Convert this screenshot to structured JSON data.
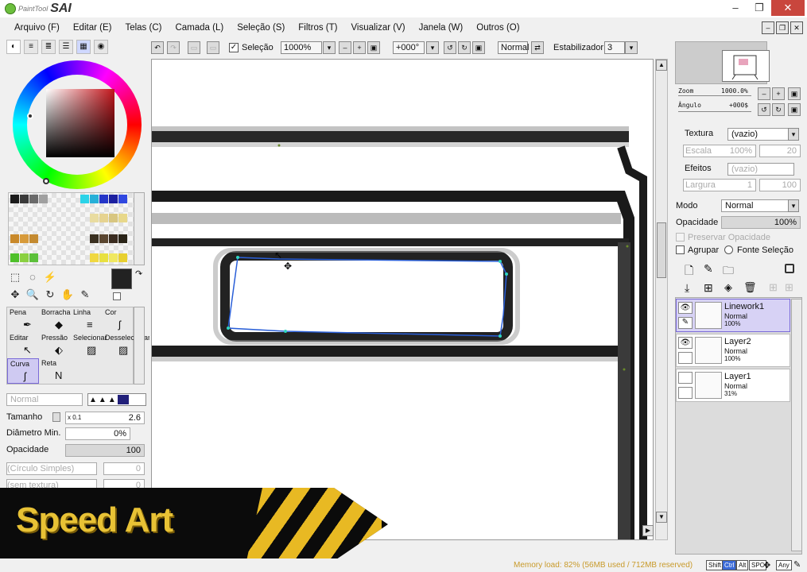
{
  "app": {
    "logo_small": "PaintTool",
    "logo_big": "SAI"
  },
  "window_buttons": {
    "minimize": "–",
    "restore": "❐",
    "close": "✕"
  },
  "menu": [
    "Arquivo (F)",
    "Editar (E)",
    "Telas (C)",
    "Camada (L)",
    "Seleção (S)",
    "Filtros (T)",
    "Visualizar (V)",
    "Janela (W)",
    "Outros (O)"
  ],
  "mdi_buttons": [
    "–",
    "❐",
    "✕"
  ],
  "left": {
    "tabs": [
      "◐",
      "≡",
      "≣",
      "☰",
      "▦",
      "◉"
    ],
    "tools_row1": [
      "⬚",
      "◌",
      "⚡",
      "",
      "▣"
    ],
    "tools_row2": [
      "✥",
      "🔍",
      "↻",
      "✋",
      "✎"
    ],
    "brushes": [
      {
        "name": "Pena",
        "icon": "✒"
      },
      {
        "name": "Borracha",
        "icon": "◆"
      },
      {
        "name": "Linha",
        "icon": "≡"
      },
      {
        "name": "Cor",
        "icon": "ʃ"
      },
      {
        "name": "Editar",
        "icon": "↖"
      },
      {
        "name": "Pressão",
        "icon": "⬖"
      },
      {
        "name": "Selecionar",
        "icon": "▨"
      },
      {
        "name": "Desselecionar",
        "icon": "▨"
      },
      {
        "name": "Curva",
        "icon": "ʃ"
      },
      {
        "name": "Reta",
        "icon": "N"
      }
    ],
    "blend_mode": "Normal",
    "size_label": "Tamanho",
    "size_mult": "x 0.1",
    "size_value": "2.6",
    "min_diam_label": "Diâmetro Min.",
    "min_diam_value": "0%",
    "opacity_label": "Opacidade",
    "opacity_value": "100",
    "shape_label": "(Círculo Simples)",
    "shape_value": "0",
    "texture_label": "(sem textura)",
    "texture_value": "0"
  },
  "toolbar": {
    "selection_label": "Seleção",
    "zoom": "1000%",
    "angle": "+000°",
    "mode": "Normal",
    "stabilizer_label": "Estabilizador",
    "stabilizer_value": "3"
  },
  "right": {
    "zoom_label": "Zoom",
    "zoom_value": "1000.0%",
    "angle_label": "Ângulo",
    "angle_value": "+000$",
    "texture_label": "Textura",
    "texture_value": "(vazio)",
    "scale_label": "Escala",
    "scale_value": "100%",
    "scale_num": "20",
    "effects_label": "Efeitos",
    "effects_value": "(vazio)",
    "width_label": "Largura",
    "width_value": "1",
    "width_num": "100",
    "mode_label": "Modo",
    "mode_value": "Normal",
    "opacity_label": "Opacidade",
    "opacity_value": "100%",
    "preserve_label": "Preservar Opacidade",
    "group_label": "Agrupar",
    "source_label": "Fonte Seleção",
    "layers": [
      {
        "name": "Linework1",
        "mode": "Normal",
        "opacity": "100%"
      },
      {
        "name": "Layer2",
        "mode": "Normal",
        "opacity": "100%"
      },
      {
        "name": "Layer1",
        "mode": "Normal",
        "opacity": "31%"
      }
    ]
  },
  "banner_text": "Speed Art",
  "status": {
    "memory": "Memory load: 82% (56MB used / 712MB reserved)",
    "keys": [
      "Shift",
      "Ctrl",
      "Alt",
      "SPC",
      "Any"
    ]
  },
  "colors": {
    "accent": "#7a6ad8",
    "banner_yellow": "#e8c235",
    "close": "#c9463d",
    "selection_path": "#2a5fd8"
  }
}
